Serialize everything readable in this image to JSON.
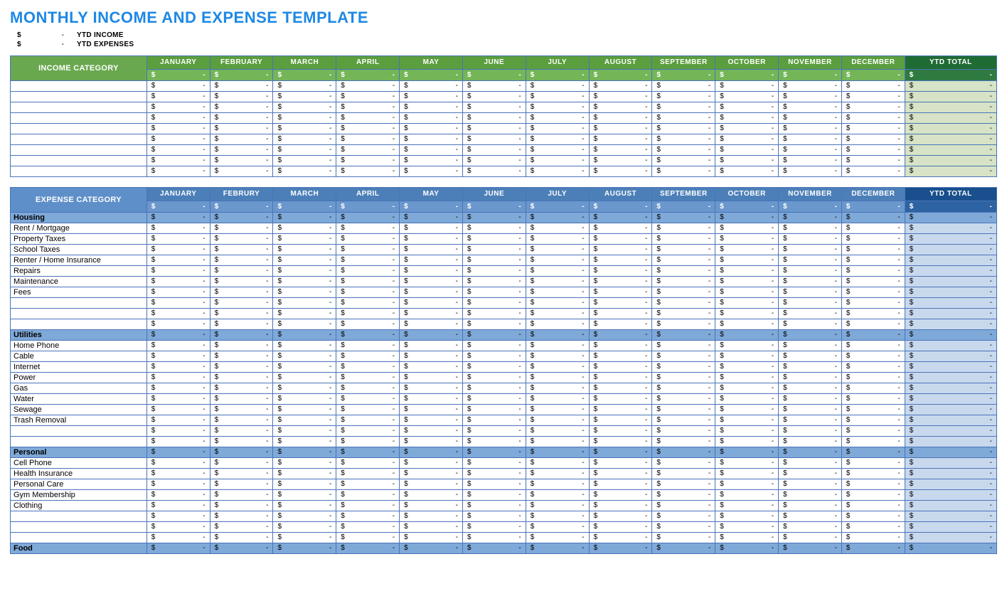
{
  "title": "MONTHLY INCOME AND EXPENSE TEMPLATE",
  "summary": [
    {
      "symbol": "$",
      "dash": "-",
      "label": "YTD INCOME"
    },
    {
      "symbol": "$",
      "dash": "-",
      "label": "YTD EXPENSES"
    }
  ],
  "months": [
    "JANUARY",
    "FEBRUARY",
    "MARCH",
    "APRIL",
    "MAY",
    "JUNE",
    "JULY",
    "AUGUST",
    "SEPTEMBER",
    "OCTOBER",
    "NOVEMBER",
    "DECEMBER"
  ],
  "months_exp": [
    "JANUARY",
    "FEBRURY",
    "MARCH",
    "APRIL",
    "MAY",
    "JUNE",
    "JULY",
    "AUGUST",
    "SEPTEMBER",
    "OCTOBER",
    "NOVEMBER",
    "DECEMBER"
  ],
  "ytd_label": "YTD TOTAL",
  "currency": "$",
  "dash": "-",
  "income": {
    "header": "INCOME CATEGORY",
    "rows": [
      "",
      "",
      "",
      "",
      "",
      "",
      "",
      "",
      ""
    ]
  },
  "expense": {
    "header": "EXPENSE CATEGORY",
    "groups": [
      {
        "name": "Housing",
        "items": [
          "Rent / Mortgage",
          "Property Taxes",
          "School Taxes",
          "Renter / Home Insurance",
          "Repairs",
          "Maintenance",
          "Fees",
          "",
          "",
          ""
        ]
      },
      {
        "name": "Utilities",
        "items": [
          "Home Phone",
          "Cable",
          "Internet",
          "Power",
          "Gas",
          "Water",
          "Sewage",
          "Trash Removal",
          "",
          ""
        ]
      },
      {
        "name": "Personal",
        "items": [
          "Cell Phone",
          "Health Insurance",
          "Personal Care",
          "Gym Membership",
          "Clothing",
          "",
          "",
          ""
        ]
      },
      {
        "name": "Food",
        "items": []
      }
    ]
  }
}
